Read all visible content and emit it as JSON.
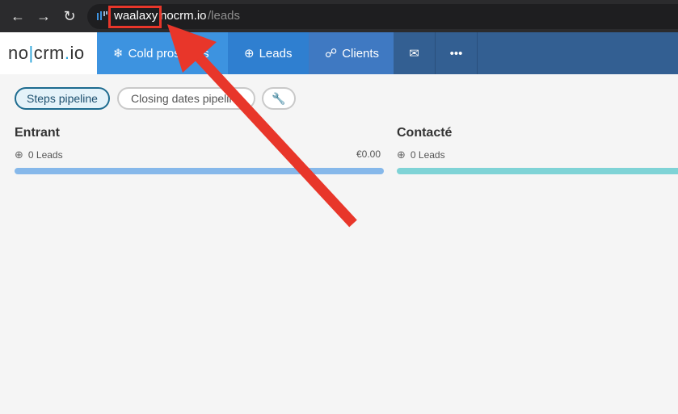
{
  "browser": {
    "url_subdomain": "waalaxy",
    "url_host": "nocrm.io",
    "url_path": "/leads"
  },
  "app": {
    "logo": {
      "left": "no",
      "sep": "|",
      "mid": "crm",
      "dot": ".",
      "right": "io"
    },
    "tabs": {
      "cold": "Cold prospects",
      "leads": "Leads",
      "clients": "Clients"
    }
  },
  "filters": {
    "steps": "Steps pipeline",
    "closing": "Closing dates pipeline"
  },
  "columns": [
    {
      "title": "Entrant",
      "count": "0 Leads",
      "amount": "€0.00",
      "color": "#86b8ea"
    },
    {
      "title": "Contacté",
      "count": "0 Leads",
      "color": "#7fd3d6"
    }
  ],
  "annotation": {
    "color": "#e8362a"
  }
}
